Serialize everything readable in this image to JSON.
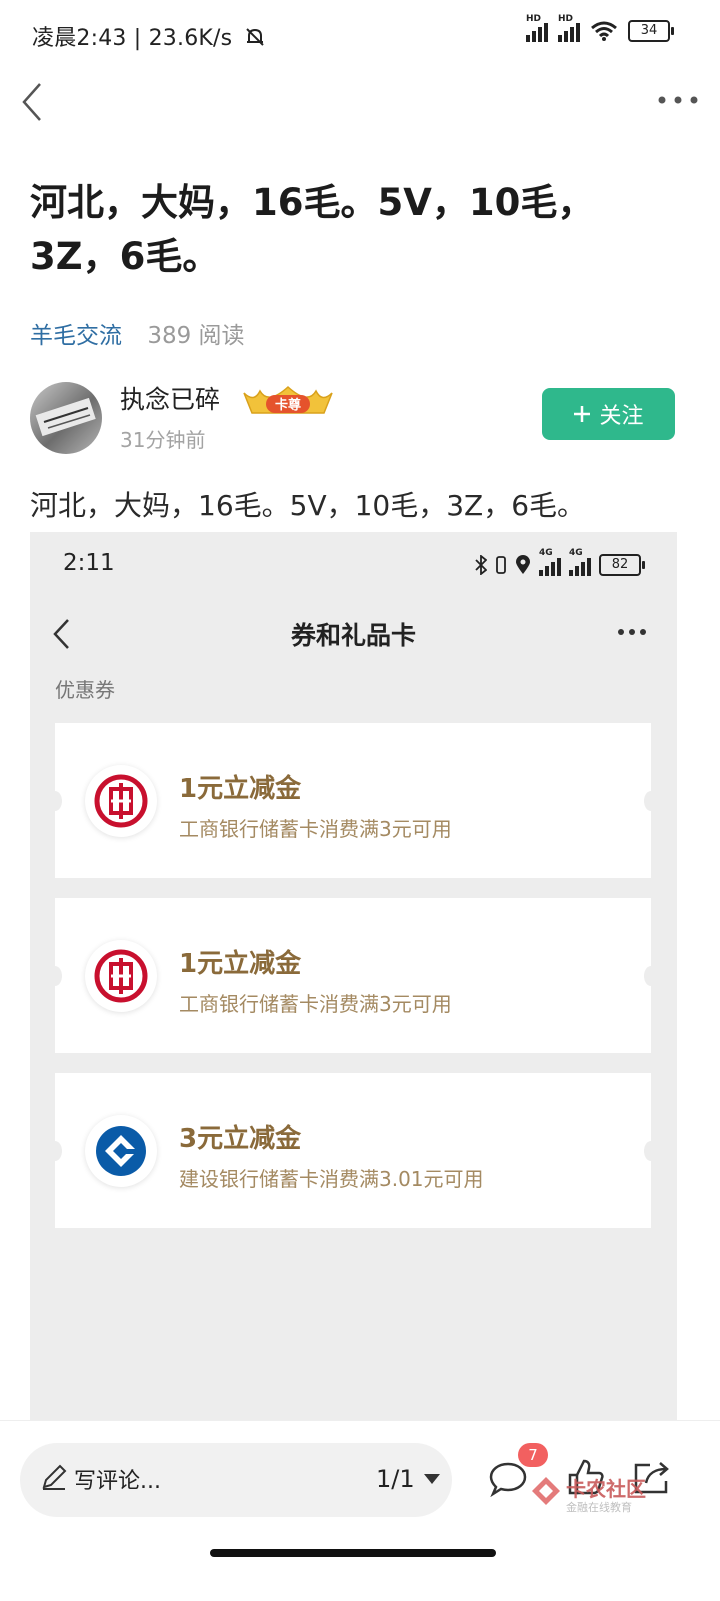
{
  "status_bar": {
    "time_speed": "凌晨2:43 | 23.6K/s",
    "network_label": "HD",
    "battery": "34"
  },
  "post": {
    "title": "河北，大妈，16毛。5V，10毛，3Z，6毛。",
    "category": "羊毛交流",
    "reads": "389 阅读",
    "author": "执念已碎",
    "badge": "卡尊",
    "time": "31分钟前",
    "follow_label": "关注",
    "body": "河北，大妈，16毛。5V，10毛，3Z，6毛。"
  },
  "embedded": {
    "time": "2:11",
    "battery": "82",
    "network_label": "4G",
    "title": "券和礼品卡",
    "section": "优惠券",
    "coupons": [
      {
        "title": "1元立减金",
        "desc": "工商银行储蓄卡消费满3元可用",
        "bank_icon": "icbc-logo-icon",
        "color": "#c8102e"
      },
      {
        "title": "1元立减金",
        "desc": "工商银行储蓄卡消费满3元可用",
        "bank_icon": "icbc-logo-icon",
        "color": "#c8102e"
      },
      {
        "title": "3元立减金",
        "desc": "建设银行储蓄卡消费满3.01元可用",
        "bank_icon": "ccb-logo-icon",
        "color": "#0a5ba8"
      }
    ]
  },
  "bottom": {
    "comment_placeholder": "写评论...",
    "page_indicator": "1/1",
    "comment_count": "7",
    "watermark_name": "卡农社区",
    "watermark_sub": "金融在线教育"
  },
  "colors": {
    "accent_green": "#2fb88c",
    "category_blue": "#2f6ea3",
    "coupon_gold": "#8a6a3a"
  }
}
